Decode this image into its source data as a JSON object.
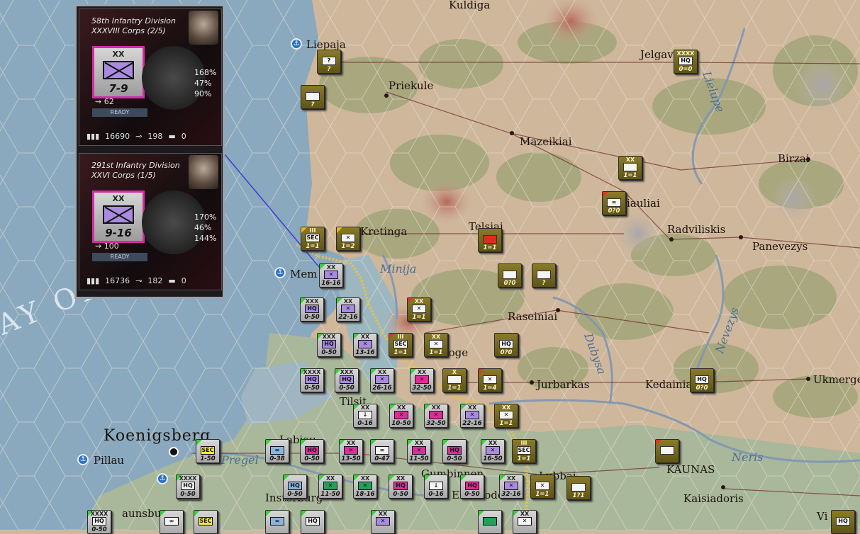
{
  "colors": {
    "sea": "#7f9fb5",
    "land": "#cdb59a",
    "front": "#e8c050",
    "route": "#3b3fd8",
    "soviet": "#7a6b22",
    "german": "#bdbdbd"
  },
  "cities": {
    "kuldiga": "Kuldiga",
    "liepaja": "Liepaja",
    "jelgava": "Jelgava",
    "priekule": "Priekule",
    "mazeikiai": "Mazeikiai",
    "birzai": "Birzai",
    "siauliai": "iauliai",
    "kretinga": "Kretinga",
    "telsiai": "Telsiai",
    "radviliskis": "Radviliskis",
    "panevezys": "Panevezys",
    "memel": "Mem",
    "raseiniai": "Raseiniai",
    "taurage": "Tauroge",
    "jurbarkas": "Jurbarkas",
    "kedainiai": "Kedainia",
    "ukmerge": "Ukmerge",
    "tilsit": "Tilsit",
    "koenigsberg": "Koenigsberg",
    "pillau": "Pillau",
    "labiau": "Labiau",
    "gumbinnen": "Gumbinnen",
    "insterburg": "Insterburg",
    "kaunas": "KAUNAS",
    "kaisiadoris": "Kaisiadoris",
    "ebenrode": "Ebenrode",
    "wilno": "Vi",
    "braunsberg": "aunsburg",
    "lubliai": "Lubbai"
  },
  "rivers": {
    "minija": "Minija",
    "dubysa": "Dubysa",
    "nevezys": "Nevezys",
    "neris": "Neris",
    "pregel": "Pregel",
    "lielupe": "Lielupe"
  },
  "sea_text": "AY OF DA",
  "panels": [
    {
      "title1": "58th Infantry Division",
      "title2": "XXXVIII Corps (2/5)",
      "level": "XX",
      "strength": "7-9",
      "p1": "168%",
      "p2": "47%",
      "p3": "90%",
      "mp": "62",
      "status": "READY",
      "men": "16690",
      "guns": "198",
      "tanks": "0"
    },
    {
      "title1": "291st Infantry Division",
      "title2": "XXVI Corps (1/5)",
      "level": "XX",
      "strength": "9-16",
      "p1": "170%",
      "p2": "46%",
      "p3": "144%",
      "mp": "100",
      "status": "READY",
      "men": "16736",
      "guns": "182",
      "tanks": "0"
    }
  ],
  "counters": [
    {
      "id": "s1",
      "side": "sov",
      "lvl": "",
      "sym": "?",
      "symc": "wht",
      "st": "?",
      "flag": ""
    },
    {
      "id": "s2",
      "side": "sov",
      "lvl": "",
      "sym": "",
      "symc": "wht",
      "st": "?",
      "flag": ""
    },
    {
      "id": "s3",
      "side": "sov",
      "lvl": "XXXX",
      "sym": "HQ",
      "symc": "wht",
      "st": "0=0",
      "flag": ""
    },
    {
      "id": "s4",
      "side": "sov",
      "lvl": "XX",
      "sym": "",
      "symc": "wht",
      "st": "1=1",
      "flag": ""
    },
    {
      "id": "s5",
      "side": "sov",
      "lvl": "",
      "sym": "∞",
      "symc": "wht",
      "st": "0?0",
      "flag": "r"
    },
    {
      "id": "s6",
      "side": "sov",
      "lvl": "III",
      "sym": "SEC",
      "symc": "wht",
      "st": "1=1",
      "flag": "y"
    },
    {
      "id": "s7",
      "side": "sov",
      "lvl": "",
      "sym": "✕",
      "symc": "wht",
      "st": "1=2",
      "flag": "y"
    },
    {
      "id": "s8",
      "side": "sov",
      "lvl": "",
      "sym": "",
      "symc": "red",
      "st": "1=1",
      "flag": ""
    },
    {
      "id": "s9",
      "side": "sov",
      "lvl": "",
      "sym": "",
      "symc": "wht",
      "st": "0?0",
      "flag": ""
    },
    {
      "id": "s10",
      "side": "sov",
      "lvl": "",
      "sym": "",
      "symc": "wht",
      "st": "?",
      "flag": ""
    },
    {
      "id": "s11",
      "side": "sov",
      "lvl": "XX",
      "sym": "✕",
      "symc": "wht",
      "st": "1=1",
      "flag": "r"
    },
    {
      "id": "s12",
      "side": "sov",
      "lvl": "III",
      "sym": "SEC",
      "symc": "wht",
      "st": "1=1",
      "flag": "r"
    },
    {
      "id": "s13",
      "side": "sov",
      "lvl": "XX",
      "sym": "✕",
      "symc": "wht",
      "st": "1=1",
      "flag": ""
    },
    {
      "id": "s14",
      "side": "sov",
      "lvl": "",
      "sym": "HQ",
      "symc": "wht",
      "st": "0?0",
      "flag": ""
    },
    {
      "id": "s15",
      "side": "sov",
      "lvl": "X",
      "sym": "",
      "symc": "wht",
      "st": "1=1",
      "flag": ""
    },
    {
      "id": "s16",
      "side": "sov",
      "lvl": "",
      "sym": "✕",
      "symc": "wht",
      "st": "1=4",
      "flag": "r"
    },
    {
      "id": "s17",
      "side": "sov",
      "lvl": "",
      "sym": "HQ",
      "symc": "wht",
      "st": "0?0",
      "flag": ""
    },
    {
      "id": "s18",
      "side": "sov",
      "lvl": "XX",
      "sym": "✕",
      "symc": "wht",
      "st": "1=1",
      "flag": ""
    },
    {
      "id": "s19",
      "side": "sov",
      "lvl": "III",
      "sym": "SEC",
      "symc": "wht",
      "st": "1=1",
      "flag": ""
    },
    {
      "id": "s20",
      "side": "sov",
      "lvl": "",
      "sym": "",
      "symc": "wht",
      "st": "",
      "flag": "r"
    },
    {
      "id": "s21",
      "side": "sov",
      "lvl": "",
      "sym": "✕",
      "symc": "wht",
      "st": "1=1",
      "flag": ""
    },
    {
      "id": "s22",
      "side": "sov",
      "lvl": "",
      "sym": "",
      "symc": "wht",
      "st": "1?1",
      "flag": ""
    },
    {
      "id": "s23",
      "side": "sov",
      "lvl": "",
      "sym": "HQ",
      "symc": "wht",
      "st": "",
      "flag": ""
    },
    {
      "id": "g1",
      "side": "ger",
      "lvl": "XX",
      "sym": "✕",
      "symc": "inf",
      "st": "16-16",
      "flag": "g"
    },
    {
      "id": "g2",
      "side": "ger",
      "lvl": "XXX",
      "sym": "HQ",
      "symc": "inf",
      "st": "0-50",
      "flag": "g"
    },
    {
      "id": "g3",
      "side": "ger",
      "lvl": "XX",
      "sym": "✕",
      "symc": "inf",
      "st": "22-16",
      "flag": "g"
    },
    {
      "id": "g4",
      "side": "ger",
      "lvl": "XXX",
      "sym": "HQ",
      "symc": "inf",
      "st": "0-50",
      "flag": "g"
    },
    {
      "id": "g5",
      "side": "ger",
      "lvl": "XX",
      "sym": "✕",
      "symc": "inf",
      "st": "13-16",
      "flag": "g"
    },
    {
      "id": "g6",
      "side": "ger",
      "lvl": "XXXX",
      "sym": "HQ",
      "symc": "inf",
      "st": "0-50",
      "flag": "g"
    },
    {
      "id": "g7",
      "side": "ger",
      "lvl": "XXX",
      "sym": "HQ",
      "symc": "inf",
      "st": "0-50",
      "flag": "g"
    },
    {
      "id": "g8",
      "side": "ger",
      "lvl": "XX",
      "sym": "✕",
      "symc": "inf",
      "st": "26-16",
      "flag": "g"
    },
    {
      "id": "g9",
      "side": "ger",
      "lvl": "XX",
      "sym": "✕",
      "symc": "mag",
      "st": "32-50",
      "flag": "g"
    },
    {
      "id": "g10",
      "side": "ger",
      "lvl": "XX",
      "sym": "↓",
      "symc": "wht",
      "st": "0-16",
      "flag": "g"
    },
    {
      "id": "g11",
      "side": "ger",
      "lvl": "XX",
      "sym": "✕",
      "symc": "mag",
      "st": "10-50",
      "flag": "g"
    },
    {
      "id": "g12",
      "side": "ger",
      "lvl": "XX",
      "sym": "✕",
      "symc": "mag",
      "st": "32-50",
      "flag": "g"
    },
    {
      "id": "g13",
      "side": "ger",
      "lvl": "XX",
      "sym": "✕",
      "symc": "inf",
      "st": "22-16",
      "flag": "g"
    },
    {
      "id": "g14",
      "side": "ger",
      "lvl": "",
      "sym": "SEC",
      "symc": "yel",
      "st": "1-50",
      "flag": "g"
    },
    {
      "id": "g15",
      "side": "ger",
      "lvl": "",
      "sym": "∞",
      "symc": "blu",
      "st": "0-38",
      "flag": "g"
    },
    {
      "id": "g16",
      "side": "ger",
      "lvl": "",
      "sym": "HQ",
      "symc": "mag",
      "st": "0-50",
      "flag": "g"
    },
    {
      "id": "g17",
      "side": "ger",
      "lvl": "XX",
      "sym": "✕",
      "symc": "mag",
      "st": "13-50",
      "flag": "g"
    },
    {
      "id": "g18",
      "side": "ger",
      "lvl": "",
      "sym": "∞",
      "symc": "wht",
      "st": "0-47",
      "flag": "g"
    },
    {
      "id": "g19",
      "side": "ger",
      "lvl": "XX",
      "sym": "✕",
      "symc": "mag",
      "st": "11-50",
      "flag": "g"
    },
    {
      "id": "g20",
      "side": "ger",
      "lvl": "",
      "sym": "HQ",
      "symc": "mag",
      "st": "0-50",
      "flag": "g"
    },
    {
      "id": "g21",
      "side": "ger",
      "lvl": "XX",
      "sym": "✕",
      "symc": "inf",
      "st": "16-50",
      "flag": "g"
    },
    {
      "id": "g22",
      "side": "ger",
      "lvl": "III",
      "sym": "SEC",
      "symc": "wht",
      "st": "1=1",
      "flag": "g"
    },
    {
      "id": "g23",
      "side": "ger",
      "lvl": "XXXX",
      "sym": "HQ",
      "symc": "wht",
      "st": "0-50",
      "flag": "g"
    },
    {
      "id": "g24",
      "side": "ger",
      "lvl": "",
      "sym": "HQ",
      "symc": "blu",
      "st": "0-50",
      "flag": "g"
    },
    {
      "id": "g25",
      "side": "ger",
      "lvl": "XX",
      "sym": "✕",
      "symc": "grn",
      "st": "11-50",
      "flag": "g"
    },
    {
      "id": "g26",
      "side": "ger",
      "lvl": "XX",
      "sym": "✕",
      "symc": "grn",
      "st": "18-16",
      "flag": "g"
    },
    {
      "id": "g27",
      "side": "ger",
      "lvl": "XX",
      "sym": "HQ",
      "symc": "mag",
      "st": "0-50",
      "flag": "g"
    },
    {
      "id": "g28",
      "side": "ger",
      "lvl": "",
      "sym": "↓",
      "symc": "wht",
      "st": "0-16",
      "flag": "g"
    },
    {
      "id": "g29",
      "side": "ger",
      "lvl": "",
      "sym": "HQ",
      "symc": "mag",
      "st": "0-50",
      "flag": "g"
    },
    {
      "id": "g30",
      "side": "ger",
      "lvl": "XX",
      "sym": "✕",
      "symc": "inf",
      "st": "32-16",
      "flag": "g"
    },
    {
      "id": "g31",
      "side": "ger",
      "lvl": "XXXX",
      "sym": "HQ",
      "symc": "wht",
      "st": "0-50",
      "flag": "g"
    },
    {
      "id": "g32",
      "side": "ger",
      "lvl": "",
      "sym": "∞",
      "symc": "wht",
      "st": "",
      "flag": "g"
    },
    {
      "id": "g33",
      "side": "ger",
      "lvl": "",
      "sym": "SEC",
      "symc": "yel",
      "st": "",
      "flag": "g"
    },
    {
      "id": "g34",
      "side": "ger",
      "lvl": "",
      "sym": "∞",
      "symc": "blu",
      "st": "",
      "flag": "g"
    },
    {
      "id": "g35",
      "side": "ger",
      "lvl": "",
      "sym": "HQ",
      "symc": "wht",
      "st": "",
      "flag": "g"
    },
    {
      "id": "g36",
      "side": "ger",
      "lvl": "XX",
      "sym": "✕",
      "symc": "inf",
      "st": "",
      "flag": "g"
    },
    {
      "id": "g37",
      "side": "ger",
      "lvl": "",
      "sym": "",
      "symc": "grn",
      "st": "",
      "flag": "g"
    },
    {
      "id": "g38",
      "side": "ger",
      "lvl": "XX",
      "sym": "✕",
      "symc": "wht",
      "st": "",
      "flag": "g"
    }
  ]
}
